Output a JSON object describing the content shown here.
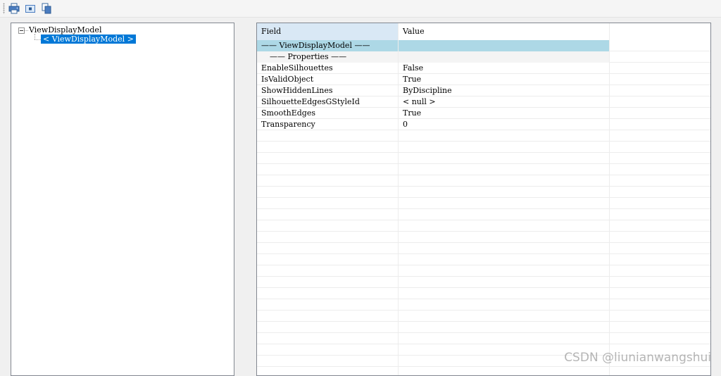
{
  "toolbar": {
    "buttons": [
      {
        "name": "print-icon"
      },
      {
        "name": "snoop-icon"
      },
      {
        "name": "copy-icon"
      }
    ]
  },
  "tree": {
    "root_label": "ViewDisplayModel",
    "child_label": "< ViewDisplayModel >"
  },
  "grid": {
    "header": {
      "field": "Field",
      "value": "Value"
    },
    "section_title": "—— ViewDisplayModel ——",
    "subsection_title": "—— Properties ——",
    "rows": [
      {
        "field": "EnableSilhouettes",
        "value": "False"
      },
      {
        "field": "IsValidObject",
        "value": "True"
      },
      {
        "field": "ShowHiddenLines",
        "value": "ByDiscipline"
      },
      {
        "field": "SilhouetteEdgesGStyleId",
        "value": "< null >"
      },
      {
        "field": "SmoothEdges",
        "value": "True"
      },
      {
        "field": "Transparency",
        "value": "0"
      }
    ]
  },
  "watermark": "CSDN @liunianwangshui",
  "colors": {
    "selection": "#0078d7",
    "section_header": "#add8e6",
    "field_header": "#d9e8f5"
  }
}
